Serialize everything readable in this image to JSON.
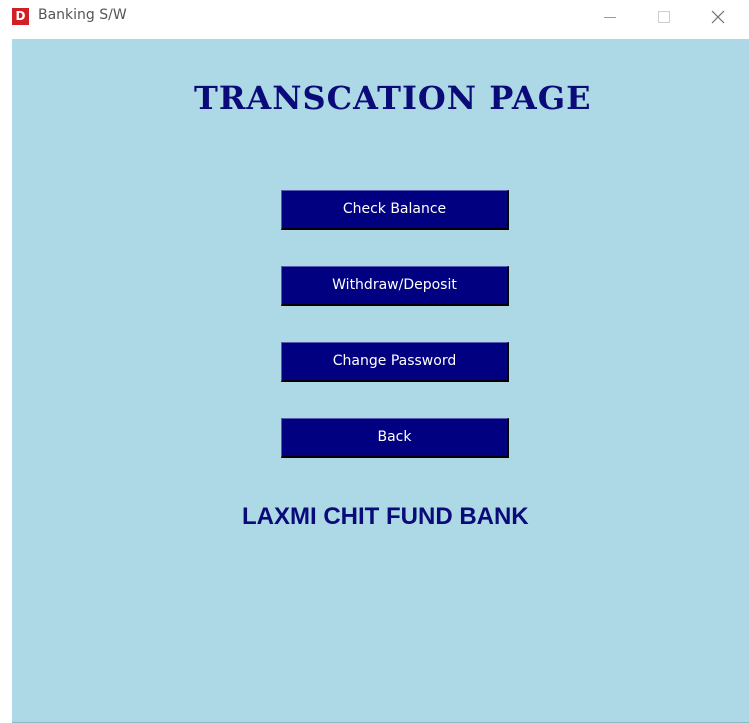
{
  "window": {
    "title": "Banking S/W",
    "app_icon_glyph": "D",
    "app_icon_color": "#d11f26"
  },
  "page": {
    "title": "TRANSCATION  PAGE",
    "buttons": [
      {
        "label": "Check Balance"
      },
      {
        "label": "Withdraw/Deposit"
      },
      {
        "label": "Change Password"
      },
      {
        "label": "Back"
      }
    ],
    "bank_name": "LAXMI CHIT FUND BANK"
  },
  "colors": {
    "background": "#add8e6",
    "button_fill": "#000080",
    "heading_text": "#0a0a78"
  }
}
